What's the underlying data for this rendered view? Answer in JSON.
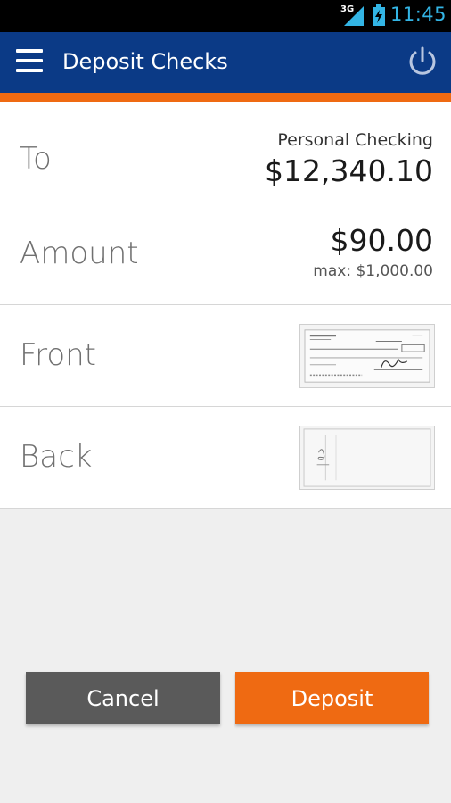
{
  "status_bar": {
    "network": "3G",
    "time": "11:45"
  },
  "header": {
    "title": "Deposit Checks",
    "menu_icon": "hamburger-menu-icon",
    "power_icon": "power-icon"
  },
  "form": {
    "to": {
      "label": "To",
      "account_name": "Personal Checking",
      "balance": "$12,340.10"
    },
    "amount": {
      "label": "Amount",
      "value": "$90.00",
      "max_note": "max: $1,000.00"
    },
    "front": {
      "label": "Front"
    },
    "back": {
      "label": "Back"
    }
  },
  "actions": {
    "cancel_label": "Cancel",
    "deposit_label": "Deposit"
  },
  "colors": {
    "header_bg": "#0b3a86",
    "accent": "#ef6a12",
    "cancel_bg": "#5a5a5a",
    "status_icon": "#33b5e5"
  }
}
